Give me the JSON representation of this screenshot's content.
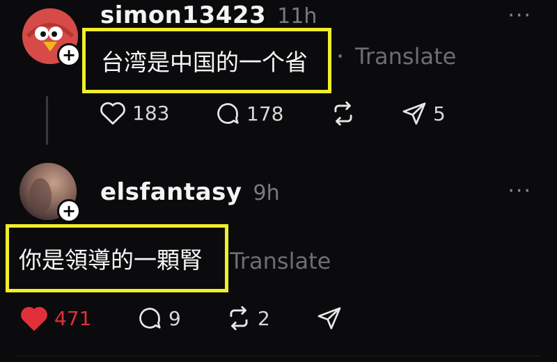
{
  "posts": [
    {
      "username": "simon13423",
      "time": "11h",
      "more": "···",
      "content": "台湾是中国的一个省",
      "translate": "Translate",
      "avatar_icon": "red-bird-avatar",
      "likes": "183",
      "comments": "178",
      "shares": "5",
      "liked": false
    },
    {
      "username": "elsfantasy",
      "time": "9h",
      "more": "···",
      "content": "你是領導的一顆腎",
      "translate": "Translate",
      "avatar_icon": "photo-avatar",
      "likes": "471",
      "comments": "9",
      "reposts": "2",
      "liked": true
    }
  ],
  "colors": {
    "background": "#0b0b0d",
    "highlight_box": "#f1ee2a",
    "liked_heart": "#e0303a",
    "muted_text": "#7a7a7e"
  }
}
